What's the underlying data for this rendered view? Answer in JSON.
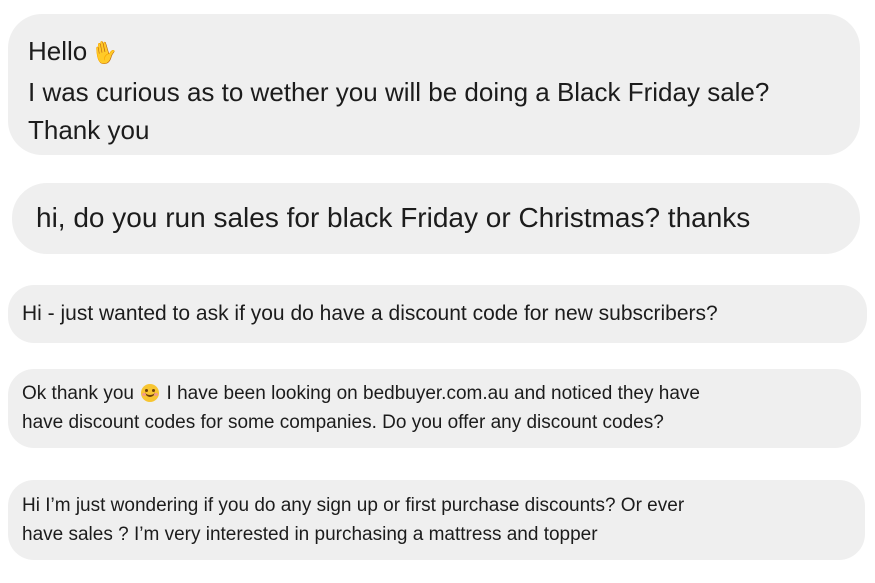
{
  "messages": [
    {
      "lines": [
        "Hello",
        "I was curious as to wether you will be doing a Black Friday sale?",
        "Thank you"
      ],
      "emoji": "waving-hand"
    },
    {
      "lines": [
        "hi, do you run sales for black Friday or Christmas? thanks"
      ]
    },
    {
      "lines": [
        "Hi - just wanted to ask if you do have a discount code for new subscribers?"
      ]
    },
    {
      "line1_before": "Ok thank you",
      "line1_after": "I have been looking on bedbuyer.com.au and noticed they have",
      "line2": "have discount codes for some companies. Do you offer any discount codes?",
      "emoji": "smiling-face"
    },
    {
      "lines": [
        "Hi I’m just wondering if you do any sign up or first purchase discounts? Or ever",
        "have sales ? I’m very interested in purchasing a mattress and topper"
      ]
    }
  ]
}
